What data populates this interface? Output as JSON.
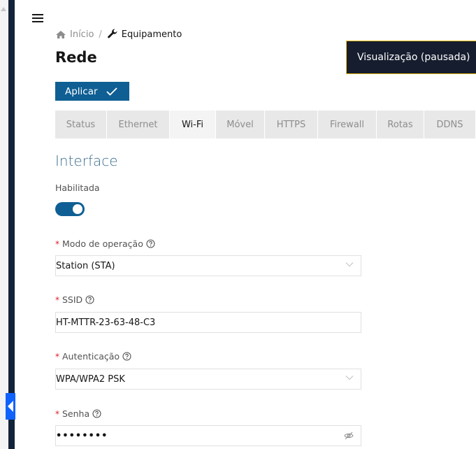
{
  "breadcrumb": {
    "home": "Início",
    "separator": "/",
    "current": "Equipamento"
  },
  "page": {
    "title": "Rede"
  },
  "preview_tag": "Visualização (pausada)",
  "apply_button": "Aplicar",
  "tabs": [
    "Status",
    "Ethernet",
    "Wi-Fi",
    "Móvel",
    "HTTPS",
    "Firewall",
    "Rotas",
    "DDNS"
  ],
  "active_tab": "Wi-Fi",
  "section": {
    "title": "Interface"
  },
  "enabled": {
    "label": "Habilitada",
    "value": true
  },
  "operation_mode": {
    "label": "Modo de operação",
    "value": "Station (STA)"
  },
  "ssid": {
    "label": "SSID",
    "value": "HT-MTTR-23-63-48-C3"
  },
  "authentication": {
    "label": "Autenticação",
    "value": "WPA/WPA2 PSK"
  },
  "password": {
    "label": "Senha",
    "value": "••••••••"
  },
  "required_mark": "*",
  "colors": {
    "primary": "#0f5f94",
    "sidebar": "#13233a",
    "handle": "#0f62fe",
    "required": "#da1e28",
    "preview_border": "#f1c21b"
  },
  "icons": {
    "menu": "hamburger-icon",
    "home": "home-icon",
    "wrench": "wrench-icon",
    "check": "checkmark-icon",
    "help": "help-circle-icon",
    "dropdown": "chevron-down-icon",
    "visibility": "eye-off-icon",
    "collapse": "chevron-left-icon"
  }
}
